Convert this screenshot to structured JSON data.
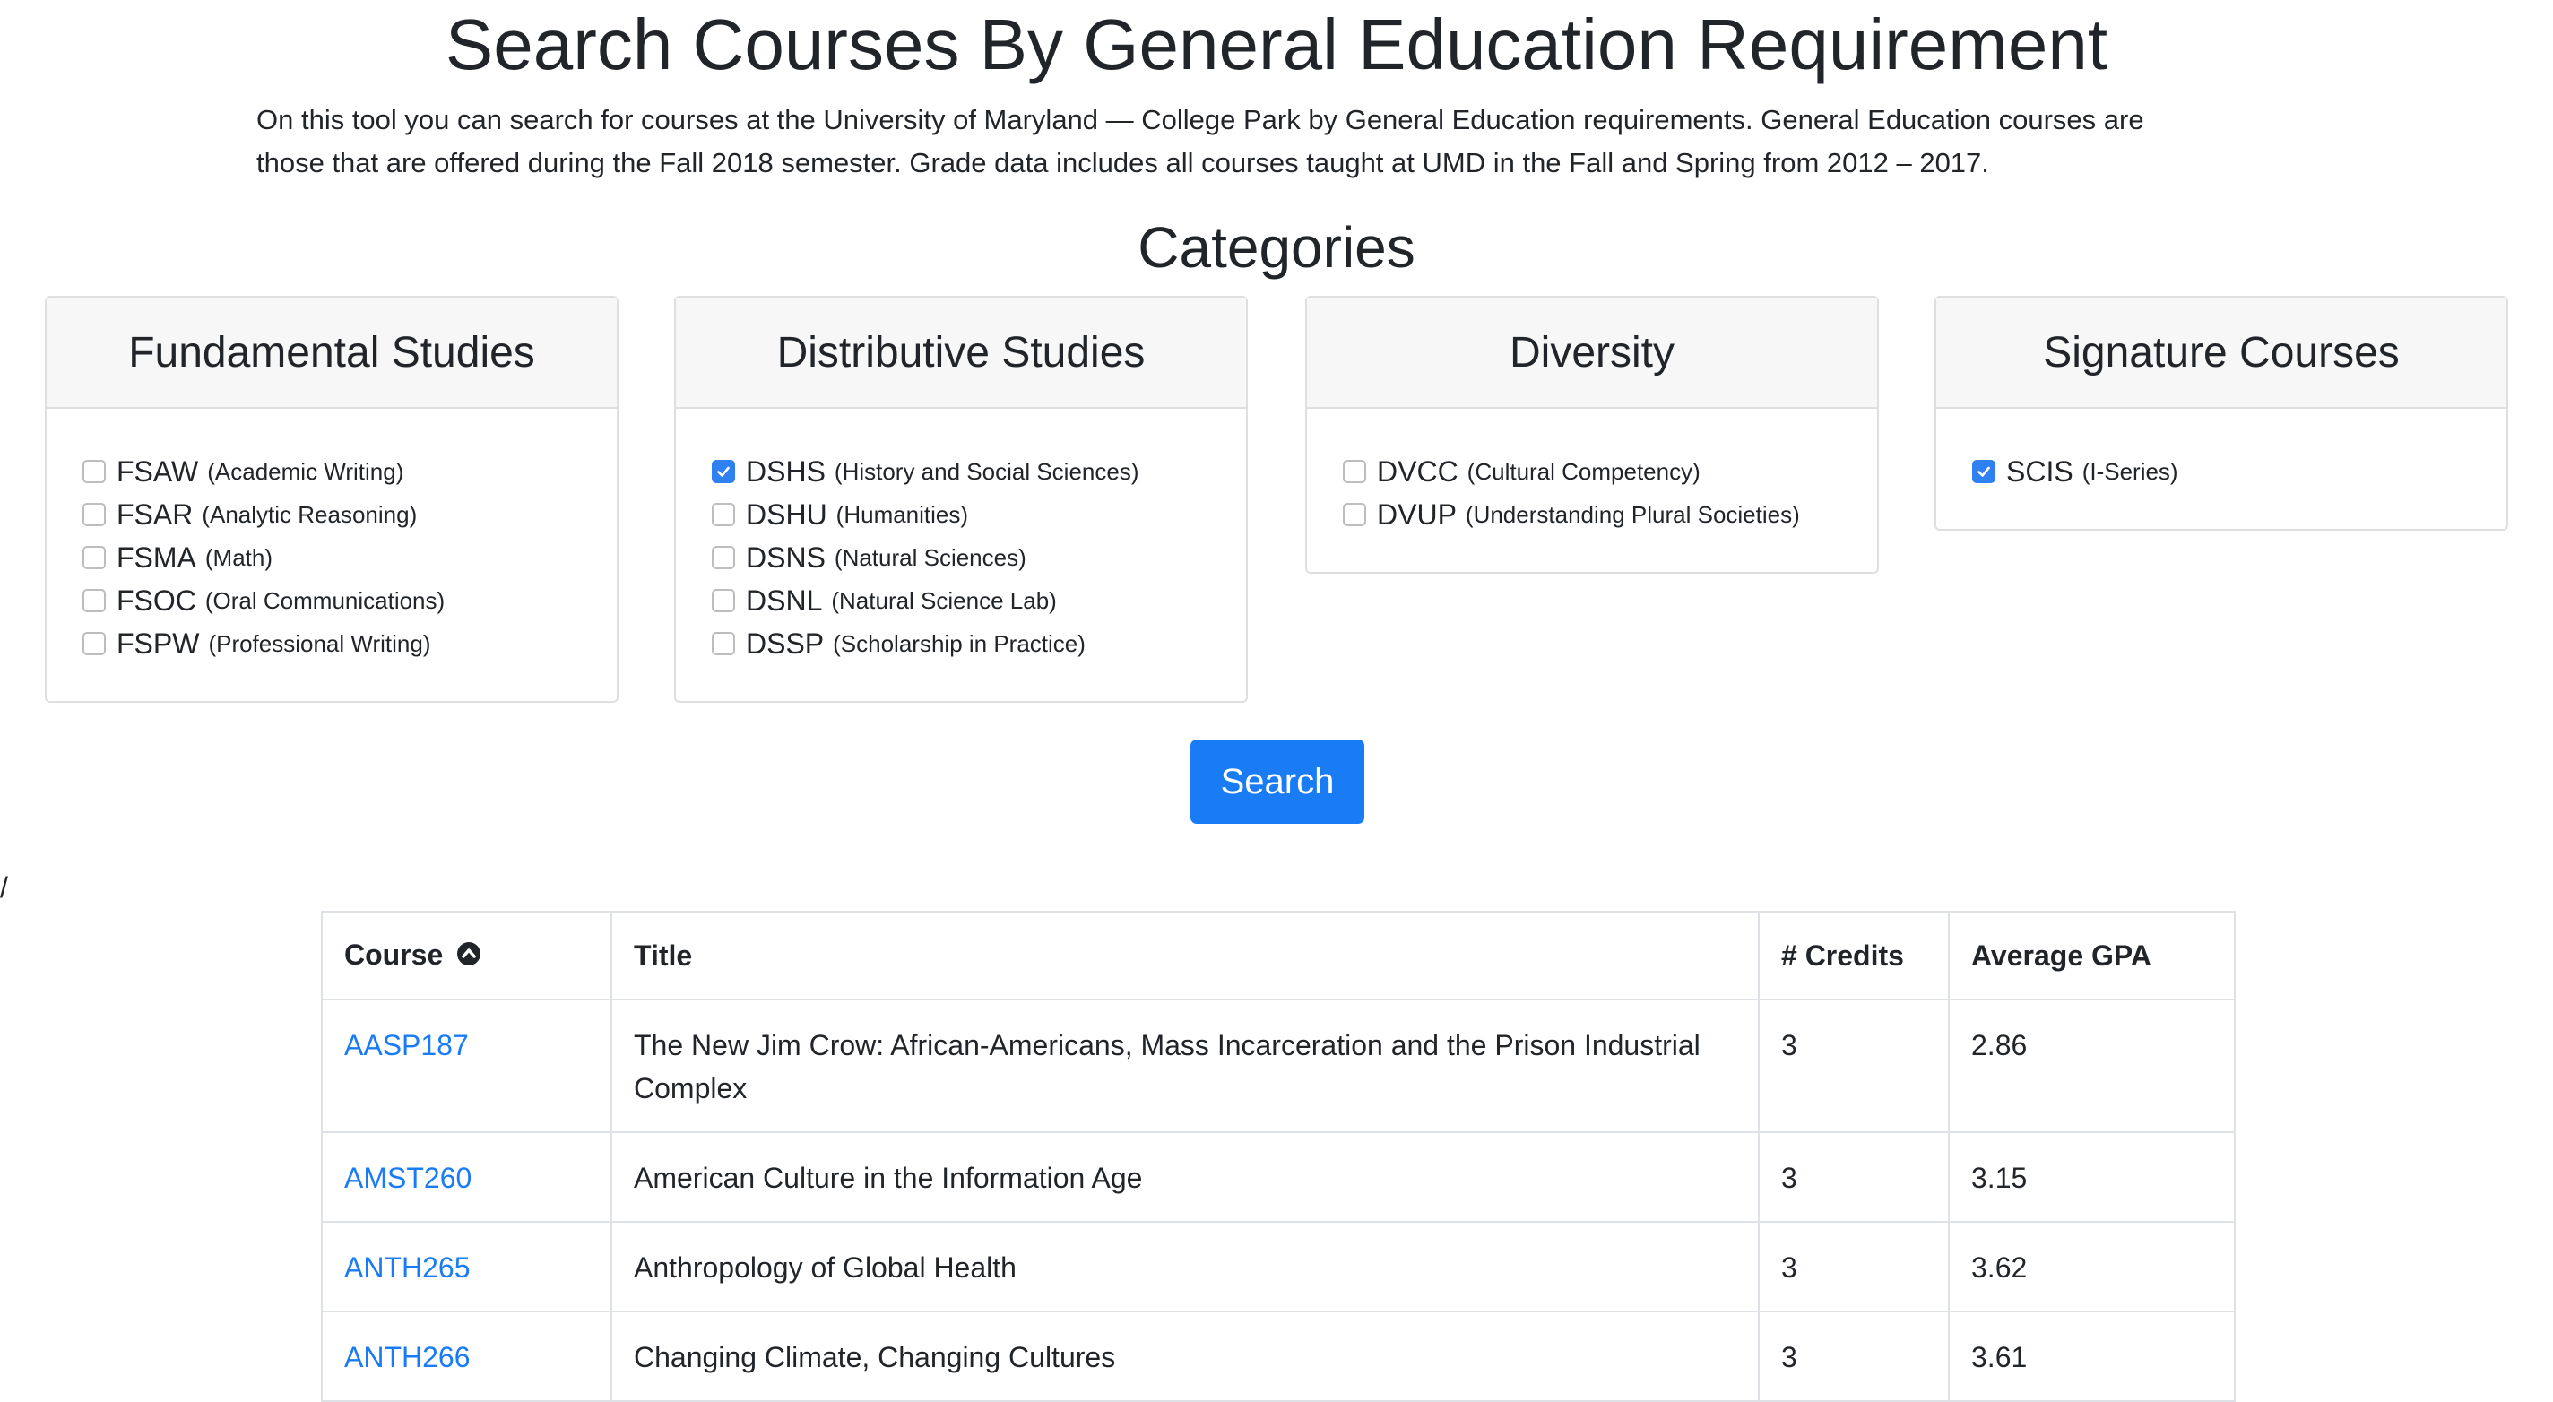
{
  "page": {
    "title": "Search Courses By General Education Requirement",
    "intro_line1": "On this tool you can search for courses at the University of Maryland — College Park by General Education requirements. General Education courses are",
    "intro_line2": "those that are offered during the Fall 2018 semester. Grade data includes all courses taught at UMD in the Fall and Spring from 2012 – 2017.",
    "categories_heading": "Categories"
  },
  "categories": [
    {
      "title": "Fundamental Studies",
      "options": [
        {
          "code": "FSAW",
          "desc": "(Academic Writing)",
          "checked": false
        },
        {
          "code": "FSAR",
          "desc": "(Analytic Reasoning)",
          "checked": false
        },
        {
          "code": "FSMA",
          "desc": "(Math)",
          "checked": false
        },
        {
          "code": "FSOC",
          "desc": "(Oral Communications)",
          "checked": false
        },
        {
          "code": "FSPW",
          "desc": "(Professional Writing)",
          "checked": false
        }
      ]
    },
    {
      "title": "Distributive Studies",
      "options": [
        {
          "code": "DSHS",
          "desc": "(History and Social Sciences)",
          "checked": true
        },
        {
          "code": "DSHU",
          "desc": "(Humanities)",
          "checked": false
        },
        {
          "code": "DSNS",
          "desc": "(Natural Sciences)",
          "checked": false
        },
        {
          "code": "DSNL",
          "desc": "(Natural Science Lab)",
          "checked": false
        },
        {
          "code": "DSSP",
          "desc": "(Scholarship in Practice)",
          "checked": false
        }
      ]
    },
    {
      "title": "Diversity",
      "options": [
        {
          "code": "DVCC",
          "desc": "(Cultural Competency)",
          "checked": false
        },
        {
          "code": "DVUP",
          "desc": "(Understanding Plural Societies)",
          "checked": false
        }
      ]
    },
    {
      "title": "Signature Courses",
      "options": [
        {
          "code": "SCIS",
          "desc": "(I-Series)",
          "checked": true
        }
      ]
    }
  ],
  "search_button": {
    "label": "Search"
  },
  "stray_text": "/",
  "table": {
    "headers": {
      "course": "Course",
      "title": "Title",
      "credits": "# Credits",
      "gpa": "Average GPA"
    },
    "sort_icon": "chevron-up-circle-icon",
    "rows": [
      {
        "course": "AASP187",
        "title": "The New Jim Crow: African-Americans, Mass Incarceration and the Prison Industrial Complex",
        "credits": "3",
        "gpa": "2.86"
      },
      {
        "course": "AMST260",
        "title": "American Culture in the Information Age",
        "credits": "3",
        "gpa": "3.15"
      },
      {
        "course": "ANTH265",
        "title": "Anthropology of Global Health",
        "credits": "3",
        "gpa": "3.62"
      },
      {
        "course": "ANTH266",
        "title": "Changing Climate, Changing Cultures",
        "credits": "3",
        "gpa": "3.61"
      }
    ]
  },
  "colors": {
    "accent": "#1a7cf5",
    "checkbox_checked": "#2f80f0"
  }
}
